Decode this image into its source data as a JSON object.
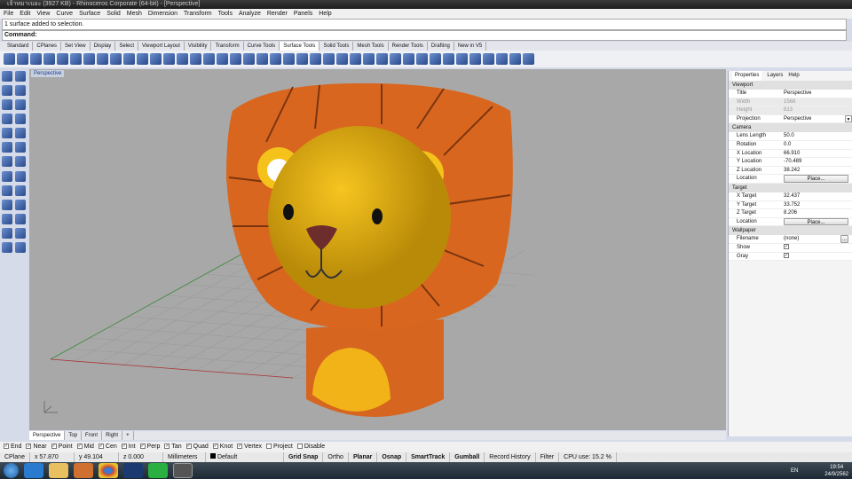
{
  "titlebar": {
    "title": "เจ้าหมาเบอะ (3927 KB) - Rhinoceros Corporate (64-bit) - [Perspective]"
  },
  "menu": [
    "File",
    "Edit",
    "View",
    "Curve",
    "Surface",
    "Solid",
    "Mesh",
    "Dimension",
    "Transform",
    "Tools",
    "Analyze",
    "Render",
    "Panels",
    "Help"
  ],
  "history": "1 surface added to selection.",
  "command_label": "Command:",
  "toolbar_tabs": [
    "Standard",
    "CPlanes",
    "Set View",
    "Display",
    "Select",
    "Viewport Layout",
    "Visibility",
    "Transform",
    "Curve Tools",
    "Surface Tools",
    "Solid Tools",
    "Mesh Tools",
    "Render Tools",
    "Drafting",
    "New in V5"
  ],
  "active_tab": "Surface Tools",
  "viewport": {
    "label": "Perspective"
  },
  "viewport_tabs": [
    "Perspective",
    "Top",
    "Front",
    "Right",
    "+"
  ],
  "osnaps": [
    {
      "label": "End",
      "checked": true
    },
    {
      "label": "Near",
      "checked": true
    },
    {
      "label": "Point",
      "checked": true
    },
    {
      "label": "Mid",
      "checked": true
    },
    {
      "label": "Cen",
      "checked": true
    },
    {
      "label": "Int",
      "checked": true
    },
    {
      "label": "Perp",
      "checked": true
    },
    {
      "label": "Tan",
      "checked": true
    },
    {
      "label": "Quad",
      "checked": true
    },
    {
      "label": "Knot",
      "checked": true
    },
    {
      "label": "Vertex",
      "checked": true
    },
    {
      "label": "Project",
      "checked": false
    },
    {
      "label": "Disable",
      "checked": false
    }
  ],
  "status": {
    "cplane": "CPlane",
    "x": "x 57.870",
    "y": "y 49.104",
    "z": "z 0.000",
    "units": "Millimeters",
    "layer": "Default",
    "grid_snap": "Grid Snap",
    "ortho": "Ortho",
    "planar": "Planar",
    "osnap": "Osnap",
    "smarttrack": "SmartTrack",
    "gumball": "Gumball",
    "record": "Record History",
    "filter": "Filter",
    "cpu": "CPU use: 15.2 %"
  },
  "panel": {
    "tabs": [
      "Properties",
      "Layers",
      "Help"
    ],
    "viewport_section": "Viewport",
    "title_k": "Title",
    "title_v": "Perspective",
    "width_k": "Width",
    "width_v": "1568",
    "height_k": "Height",
    "height_v": "813",
    "proj_k": "Projection",
    "proj_v": "Perspective",
    "camera_section": "Camera",
    "lens_k": "Lens Length",
    "lens_v": "50.0",
    "rot_k": "Rotation",
    "rot_v": "0.0",
    "xl_k": "X Location",
    "xl_v": "66.910",
    "yl_k": "Y Location",
    "yl_v": "-70.489",
    "zl_k": "Z Location",
    "zl_v": "38.242",
    "loc_k": "Location",
    "place": "Place...",
    "target_section": "Target",
    "xt_k": "X Target",
    "xt_v": "32.437",
    "yt_k": "Y Target",
    "yt_v": "33.752",
    "zt_k": "Z Target",
    "zt_v": "8.206",
    "wall_section": "Wallpaper",
    "fn_k": "Filename",
    "fn_v": "(none)",
    "show_k": "Show",
    "gray_k": "Gray",
    "check": "✓",
    "more": "..."
  },
  "tray": {
    "lang": "EN",
    "time": "19:54",
    "date": "24/9/2562"
  }
}
